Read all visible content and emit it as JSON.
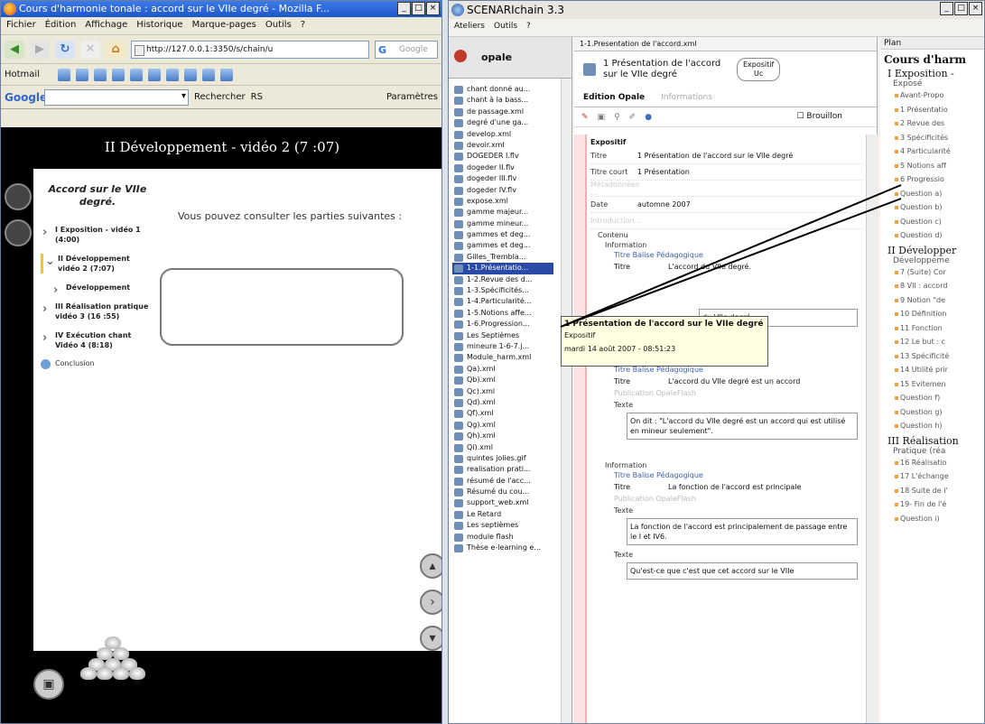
{
  "firefox": {
    "title": "Cours d'harmonie tonale : accord sur le VIIe degré - Mozilla F...",
    "menu": [
      "Fichier",
      "Édition",
      "Affichage",
      "Historique",
      "Marque-pages",
      "Outils",
      "?"
    ],
    "url": "http://127.0.0.1:3350/s/chain/u",
    "search_placeholder": "Google",
    "bookmark": "Hotmail",
    "google_label": "Google",
    "search_btn": "Rechercher",
    "rs_label": "RS",
    "params_label": "Paramètres",
    "page": {
      "banner": "II Développement - vidéo 2 (7 :07)",
      "outline_title": "Accord sur le VIIe degré.",
      "items": [
        {
          "label": "I Exposition - vidéo 1 (4:00)"
        },
        {
          "label": "II Développement vidéo 2 (7:07)"
        },
        {
          "label": "Développement"
        },
        {
          "label": "III Réalisation pratique vidéo 3 (16 :55)"
        },
        {
          "label": "IV Exécution chant Vidéo 4 (8:18)"
        }
      ],
      "conclusion": "Conclusion",
      "hint": "Vous pouvez consulter les parties suivantes :"
    }
  },
  "scenari": {
    "title": "SCENARIchain 3.3",
    "menu": [
      "Ateliers",
      "Outils",
      "?"
    ],
    "tree_header": "opale",
    "tree": [
      "chant donné au...",
      "chant à la bass...",
      "de passage.xml",
      "degré d'une ga...",
      "develop.xml",
      "devoir.xml",
      "DOGEDER I.flv",
      "dogeder II.flv",
      "dogeder III.flv",
      "dogeder IV.flv",
      "expose.xml",
      "gamme majeur...",
      "gamme mineur...",
      "gammes et deg...",
      "gammes et deg...",
      "Gilles_Trembla...",
      "1-1.Présentatio...",
      "1-2.Revue des d...",
      "1-3.Spécificités...",
      "1-4.Particularité...",
      "1-5.Notions affe...",
      "1-6.Progression...",
      "Les Septièmes",
      "mineure 1-6-7.j...",
      "Module_harm.xml",
      "Qa).xml",
      "Qb).xml",
      "Qc).xml",
      "Qd).xml",
      "Qf).xml",
      "Qg).xml",
      "Qh).xml",
      "Qi).xml",
      "quintes jolies.gif",
      "realisation prati...",
      "résumé de l'acc...",
      "Résumé du cou...",
      "support_web.xml",
      "Le Retard",
      "Les septièmes",
      "module flash",
      "Thèse e-learning e..."
    ],
    "selected_index": 16,
    "editor": {
      "tab": "1-1.Presentation de l'accord.xml",
      "heading": "1 Présentation de l'accord sur le VIIe degré",
      "badge": "Expositif",
      "badge2": "Uc",
      "tab_edit": "Edition Opale",
      "tab_info": "Informations",
      "brouillon": "Brouillon",
      "section": "Expositif",
      "fields": [
        {
          "k": "Titre",
          "v": "1 Présentation de l'accord sur le VIIe degré"
        },
        {
          "k": "Titre court",
          "v": "1 Présentation"
        },
        {
          "k": "Métadonnées ...",
          "v": ""
        },
        {
          "k": "Date",
          "v": "automne 2007"
        },
        {
          "k": "Introduction...",
          "v": ""
        }
      ],
      "contenu": "Contenu",
      "info_label": "Information",
      "titre_balise": "Titre Balise Pédagogique",
      "titre_k": "Titre",
      "b1_titre": "L'accord du VIIe degré.",
      "b1_frag": "du VIIe degré.",
      "b2_titre": "L'accord du VIIe degré est un accord",
      "pub": "Publication OpaleFlash",
      "texte": "Texte",
      "b2_text": "On dit : \"L'accord du VIIe degré est un accord qui est utilisé en mineur seulement\".",
      "b3_titre": "La fonction de l'accord est principale",
      "b3_text": "La fonction de l'accord est principalement de passage entre le I et IV6.",
      "b4_text": "Qu'est-ce que c'est que cet accord sur le VIIe"
    },
    "plan": {
      "header": "Plan",
      "title": "Cours d'harm",
      "sections": [
        {
          "label": "I Exposition -",
          "sub": "Exposé",
          "items": [
            "Avant-Propo",
            "1 Présentatio",
            "2 Revue des",
            "3 Spécificités",
            "4 Particularité",
            "5 Notions aff",
            "6 Progressio",
            "Question a)",
            "Question b)",
            "Question c)",
            "Question d)"
          ]
        },
        {
          "label": "II Développer",
          "sub": "Développeme",
          "items": [
            "7 (Suite) Cor",
            "8 VII : accord",
            "9 Notion \"de",
            "10 Définition",
            "11 Fonction",
            "12 Le but : c",
            "13 Spécificité",
            "14 Utilité prir",
            "15 Evitemen",
            "Question f)",
            "Question g)",
            "Question h)"
          ]
        },
        {
          "label": "III Réalisation",
          "sub": "Pratique (réa",
          "items": [
            "16 Réalisatio",
            "17 L'échange",
            "18 Suite de l'",
            "19- Fin de l'é",
            "Question i)"
          ]
        }
      ]
    },
    "tooltip": {
      "title": "1 Présentation de l'accord sur le VIIe degré",
      "type": "Expositif",
      "date": "mardi 14 août 2007 - 08:51:23"
    }
  }
}
